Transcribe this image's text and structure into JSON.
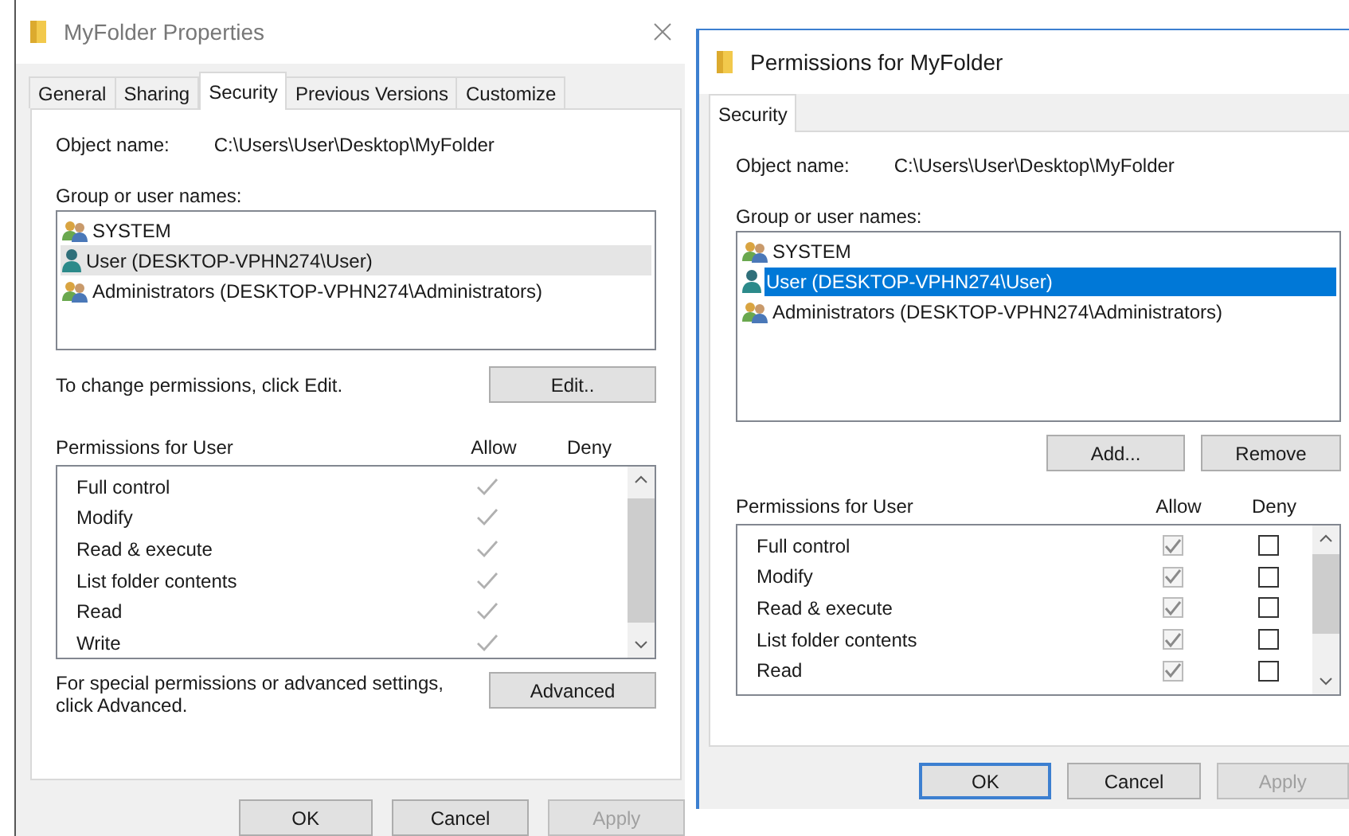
{
  "properties_dialog": {
    "title": "MyFolder Properties",
    "tabs": [
      {
        "label": "General",
        "selected": false
      },
      {
        "label": "Sharing",
        "selected": false
      },
      {
        "label": "Security",
        "selected": true
      },
      {
        "label": "Previous Versions",
        "selected": false
      },
      {
        "label": "Customize",
        "selected": false
      }
    ],
    "object_name_label": "Object name:",
    "object_name": "C:\\Users\\User\\Desktop\\MyFolder",
    "group_label": "Group or user names:",
    "list_focus": false,
    "principals": [
      {
        "kind": "group",
        "name": "SYSTEM",
        "selected": false
      },
      {
        "kind": "user",
        "name": "User (DESKTOP-VPHN274\\User)",
        "selected": true
      },
      {
        "kind": "group",
        "name": "Administrators (DESKTOP-VPHN274\\Administrators)",
        "selected": false
      }
    ],
    "edit_hint": "To change permissions, click Edit.",
    "edit_button": "Edit..",
    "permissions_label": "Permissions for User",
    "allow_header": "Allow",
    "deny_header": "Deny",
    "permissions": [
      {
        "kind": "tick",
        "label": "Full control",
        "allow": true,
        "deny": false
      },
      {
        "kind": "tick",
        "label": "Modify",
        "allow": true,
        "deny": false
      },
      {
        "kind": "tick",
        "label": "Read & execute",
        "allow": true,
        "deny": false
      },
      {
        "kind": "tick",
        "label": "List folder contents",
        "allow": true,
        "deny": false
      },
      {
        "kind": "tick",
        "label": "Read",
        "allow": true,
        "deny": false
      },
      {
        "kind": "tick",
        "label": "Write",
        "allow": true,
        "deny": false
      }
    ],
    "advanced_hint": "For special permissions or advanced settings, click Advanced.",
    "advanced_button": "Advanced",
    "buttons": [
      {
        "label": "OK",
        "disabled": false,
        "default": false
      },
      {
        "label": "Cancel",
        "disabled": false,
        "default": false
      },
      {
        "label": "Apply",
        "disabled": true,
        "default": false
      }
    ]
  },
  "permissions_dialog": {
    "title": "Permissions for MyFolder",
    "tabs": [
      {
        "label": "Security",
        "selected": true
      }
    ],
    "object_name_label": "Object name:",
    "object_name": "C:\\Users\\User\\Desktop\\MyFolder",
    "group_label": "Group or user names:",
    "list_focus": true,
    "principals": [
      {
        "kind": "group",
        "name": "SYSTEM",
        "selected": false
      },
      {
        "kind": "user",
        "name": "User (DESKTOP-VPHN274\\User)",
        "selected": true
      },
      {
        "kind": "group",
        "name": "Administrators (DESKTOP-VPHN274\\Administrators)",
        "selected": false
      }
    ],
    "add_button": "Add...",
    "remove_button": "Remove",
    "permissions_label": "Permissions for User",
    "allow_header": "Allow",
    "deny_header": "Deny",
    "allow_disabled": true,
    "permissions": [
      {
        "kind": "checkbox",
        "label": "Full control",
        "allow": true,
        "deny": false
      },
      {
        "kind": "checkbox",
        "label": "Modify",
        "allow": true,
        "deny": false
      },
      {
        "kind": "checkbox",
        "label": "Read & execute",
        "allow": true,
        "deny": false
      },
      {
        "kind": "checkbox",
        "label": "List folder contents",
        "allow": true,
        "deny": false
      },
      {
        "kind": "checkbox",
        "label": "Read",
        "allow": true,
        "deny": false
      }
    ],
    "buttons": [
      {
        "label": "OK",
        "disabled": false,
        "default": true
      },
      {
        "label": "Cancel",
        "disabled": false,
        "default": false
      },
      {
        "label": "Apply",
        "disabled": true,
        "default": false
      }
    ]
  }
}
